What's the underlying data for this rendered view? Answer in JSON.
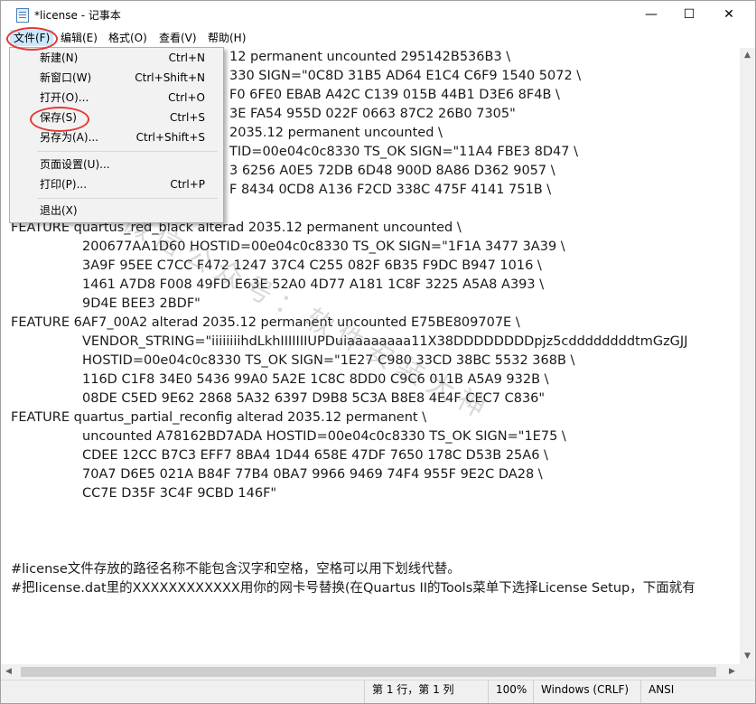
{
  "window": {
    "title": "*license - 记事本",
    "minimize": "—",
    "maximize": "☐",
    "close": "✕"
  },
  "menubar": {
    "file": "文件(F)",
    "edit": "编辑(E)",
    "format": "格式(O)",
    "view": "查看(V)",
    "help": "帮助(H)"
  },
  "file_menu": [
    {
      "label": "新建(N)",
      "shortcut": "Ctrl+N"
    },
    {
      "label": "新窗口(W)",
      "shortcut": "Ctrl+Shift+N"
    },
    {
      "label": "打开(O)...",
      "shortcut": "Ctrl+O"
    },
    {
      "label": "保存(S)",
      "shortcut": "Ctrl+S"
    },
    {
      "label": "另存为(A)...",
      "shortcut": "Ctrl+Shift+S"
    },
    {
      "label": "页面设置(U)...",
      "shortcut": ""
    },
    {
      "label": "打印(P)...",
      "shortcut": "Ctrl+P"
    },
    {
      "label": "退出(X)",
      "shortcut": ""
    }
  ],
  "editor_lines": [
    "12 permanent uncounted 295142B536B3 \\",
    "330 SIGN=\"0C8D 31B5 AD64 E1C4 C6F9 1540 5072 \\",
    "F0 6FE0 EBAB A42C C139 015B 44B1 D3E6 8F4B \\",
    "3E FA54 955D 022F 0663 87C2 26B0 7305\"",
    "2035.12 permanent uncounted \\",
    "TID=00e04c0c8330 TS_OK SIGN=\"11A4 FBE3 8D47 \\",
    "3 6256 A0E5 72DB 6D48 900D 8A86 D362 9057 \\",
    "F 8434 0CD8 A136 F2CD 338C 475F 4141 751B \\",
    "",
    "FEATURE quartus_red_black alterad 2035.12 permanent uncounted \\",
    "200677AA1D60 HOSTID=00e04c0c8330 TS_OK SIGN=\"1F1A 3477 3A39 \\",
    "3A9F 95EE C7CC F472 1247 37C4 C255 082F 6B35 F9DC B947 1016 \\",
    "1461 A7D8 F008 49FD E63E 52A0 4D77 A181 1C8F 3225 A5A8 A393 \\",
    "9D4E BEE3 2BDF\"",
    "FEATURE 6AF7_00A2 alterad 2035.12 permanent uncounted E75BE809707E \\",
    "VENDOR_STRING=\"iiiiiiiihdLkhIIIIIIIUPDuiaaaaaaaa11X38DDDDDDDDpjz5cddddddddtmGzGJJ",
    "HOSTID=00e04c0c8330 TS_OK SIGN=\"1E27 C980 33CD 38BC 5532 368B \\",
    "116D C1F8 34E0 5436 99A0 5A2E 1C8C 8DD0 C9C6 011B A5A9 932B \\",
    "08DE C5ED 9E62 2868 5A32 6397 D9B8 5C3A B8E8 4E4F CEC7 C836\"",
    "FEATURE quartus_partial_reconfig alterad 2035.12 permanent \\",
    "uncounted A78162BD7ADA HOSTID=00e04c0c8330 TS_OK SIGN=\"1E75 \\",
    "CDEE 12CC B7C3 EFF7 8BA4 1D44 658E 47DF 7650 178C D53B 25A6 \\",
    "70A7 D6E5 021A B84F 77B4 0BA7 9966 9469 74F4 955F 9E2C DA28 \\",
    "CC7E D35F 3C4F 9CBD 146F\"",
    "",
    "",
    "",
    "#license文件存放的路径名称不能包含汉字和空格，空格可以用下划线代替。",
    "#把license.dat里的XXXXXXXXXXXX用你的网卡号替换(在Quartus II的Tools菜单下选择License Setup，下面就有"
  ],
  "watermark": "微信公众号：软件安装大神",
  "statusbar": {
    "position": "第 1 行，第 1 列",
    "zoom": "100%",
    "line_ending": "Windows (CRLF)",
    "encoding": "ANSI"
  },
  "highlight_color": "#e53935"
}
